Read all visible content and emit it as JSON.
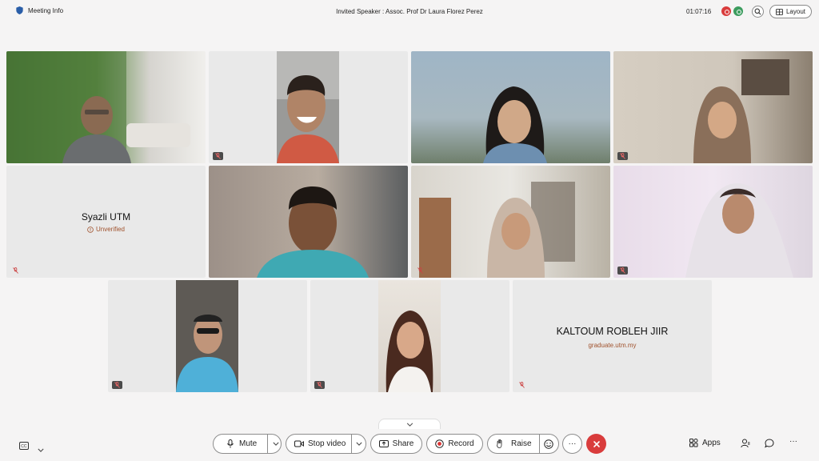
{
  "topbar": {
    "meeting_info": "Meeting Info",
    "title": "Invited Speaker : Assoc. Prof Dr Laura Florez Perez",
    "timer": "01:07:16",
    "layout_label": "Layout"
  },
  "participants": [
    {
      "id": "p1",
      "kind": "video",
      "bg": "#3f6b2f",
      "person": "man-glasses"
    },
    {
      "id": "p2",
      "kind": "video",
      "bg": "#9a9a98",
      "person": "man-smiling"
    },
    {
      "id": "p3",
      "kind": "video",
      "bg": "#8ea6b8",
      "person": "woman-long-hair"
    },
    {
      "id": "p4",
      "kind": "video",
      "bg": "#cfc7bb",
      "person": "woman-hijab"
    },
    {
      "id": "p5",
      "kind": "name",
      "name": "Syazli UTM",
      "sub": "Unverified"
    },
    {
      "id": "p6",
      "kind": "video",
      "bg": "#9c9088",
      "person": "man-teal-shirt"
    },
    {
      "id": "p7",
      "kind": "video",
      "bg": "#e9e7e2",
      "person": "woman-hijab-office"
    },
    {
      "id": "p8",
      "kind": "video",
      "bg": "#f1e8f2",
      "person": "woman-hijab-white"
    },
    {
      "id": "p9",
      "kind": "video",
      "bg": "#5e5a55",
      "person": "man-car"
    },
    {
      "id": "p10",
      "kind": "video",
      "bg": "#d9d2ca",
      "person": "woman-smiling"
    },
    {
      "id": "p11",
      "kind": "name",
      "name": "KALTOUM  ROBLEH JIIR",
      "sub": "graduate.utm.my"
    }
  ],
  "controls": {
    "mute": "Mute",
    "stop_video": "Stop video",
    "share": "Share",
    "record": "Record",
    "raise": "Raise",
    "more": "···",
    "apps": "Apps",
    "overflow": "···"
  },
  "colors": {
    "accent_red": "#d93c3c",
    "record_red": "#d33",
    "unverified": "#a0522d",
    "pill_border": "#8d8d8d"
  }
}
